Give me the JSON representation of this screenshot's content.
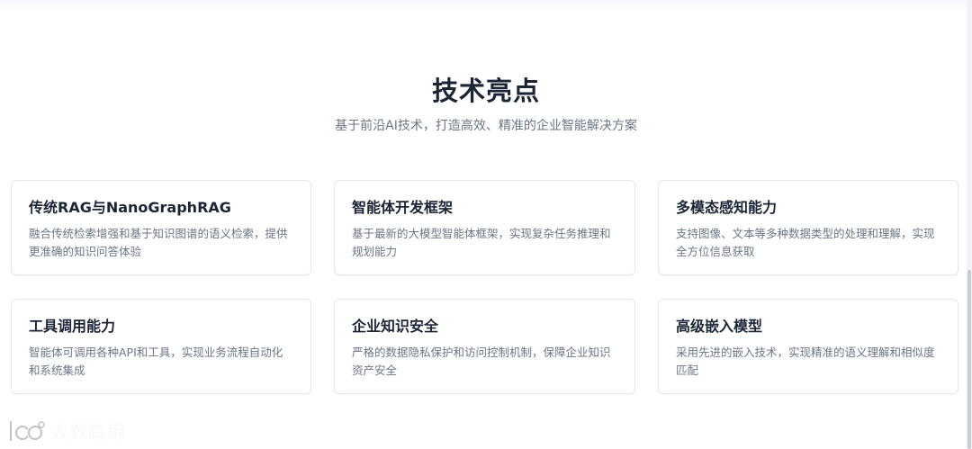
{
  "section": {
    "title": "技术亮点",
    "subtitle": "基于前沿AI技术，打造高效、精准的企业智能解决方案"
  },
  "features": [
    {
      "title": "传统RAG与NanoGraphRAG",
      "description": "融合传统检索增强和基于知识图谱的语义检索，提供更准确的知识问答体验"
    },
    {
      "title": "智能体开发框架",
      "description": "基于最新的大模型智能体框架，实现复杂任务推理和规划能力"
    },
    {
      "title": "多模态感知能力",
      "description": "支持图像、文本等多种数据类型的处理和理解，实现全方位信息获取"
    },
    {
      "title": "工具调用能力",
      "description": "智能体可调用各种API和工具，实现业务流程自动化和系统集成"
    },
    {
      "title": "企业知识安全",
      "description": "严格的数据隐私保护和访问控制机制，保障企业知识资产安全"
    },
    {
      "title": "高级嵌入模型",
      "description": "采用先进的嵌入技术，实现精准的语义理解和相似度匹配"
    }
  ],
  "watermark": {
    "text": "大数跨境"
  },
  "colors": {
    "title": "#1b2535",
    "body_text": "#6b7686",
    "card_border": "#e3e8ef",
    "background": "#ffffff"
  }
}
